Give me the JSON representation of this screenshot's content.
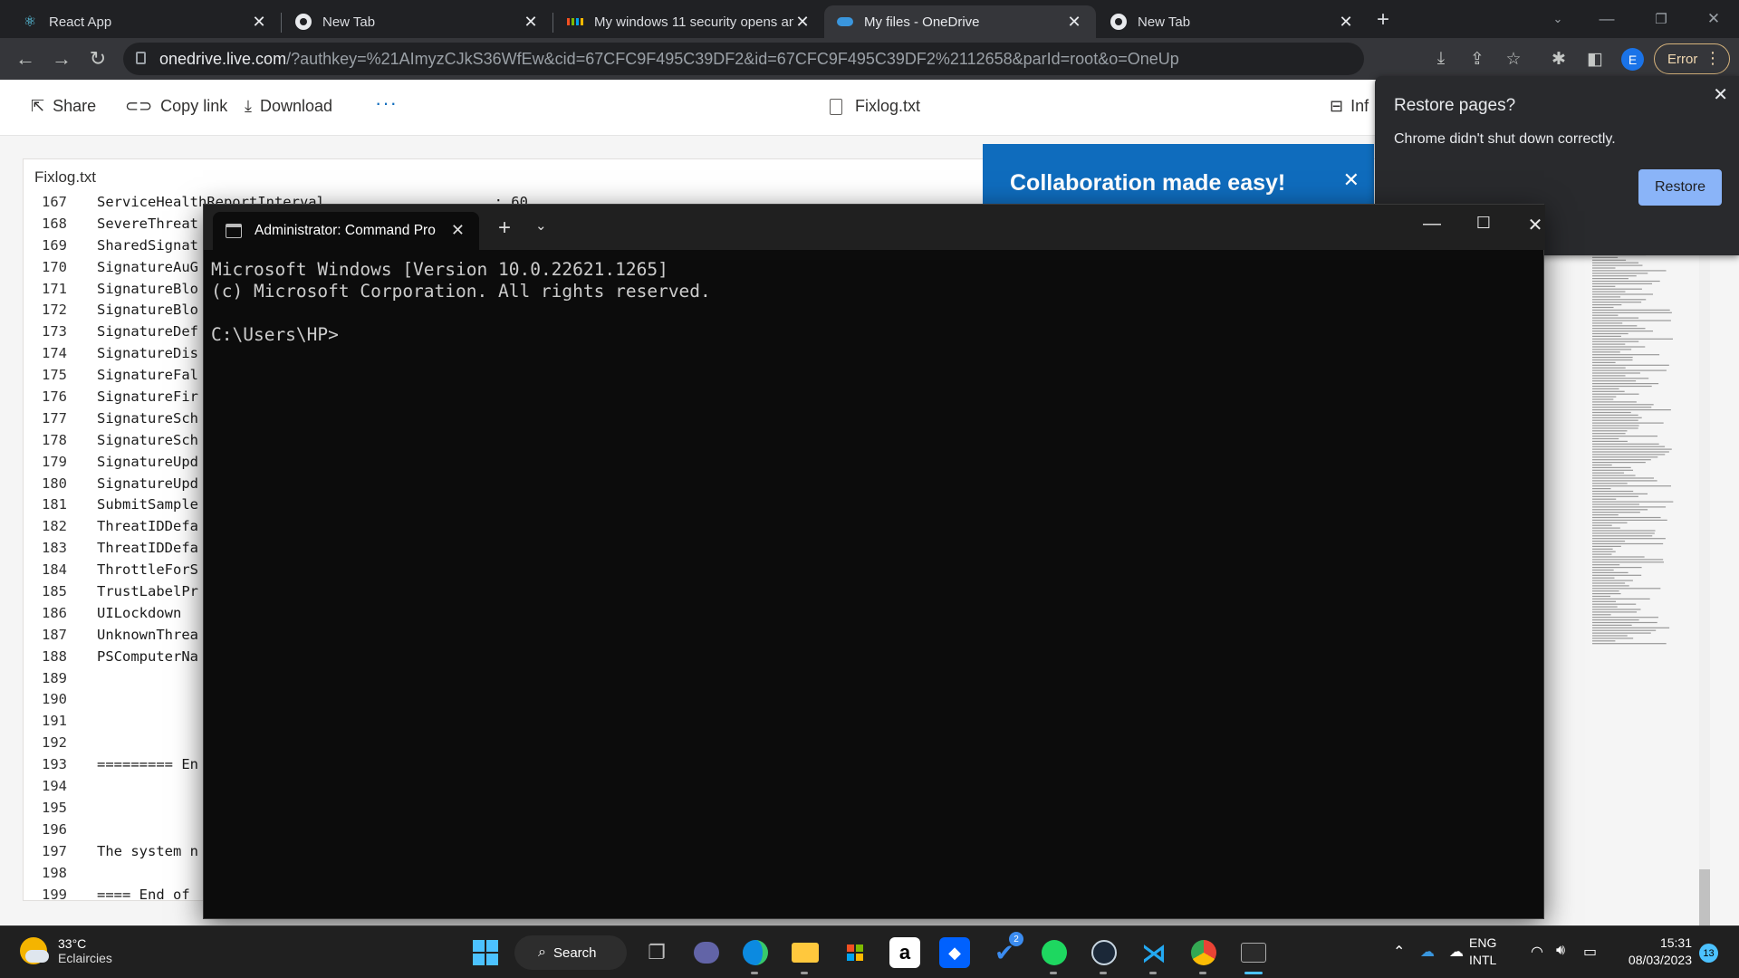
{
  "browser": {
    "tabs": [
      {
        "label": "React App",
        "icon": "react-icon"
      },
      {
        "label": "New Tab",
        "icon": "chrome-icon"
      },
      {
        "label": "My windows 11 security opens an",
        "icon": "microsoft-icon"
      },
      {
        "label": "My files - OneDrive",
        "icon": "onedrive-icon",
        "active": true
      },
      {
        "label": "New Tab",
        "icon": "chrome-icon"
      }
    ],
    "url_host": "onedrive.live.com",
    "url_rest": "/?authkey=%21AImyzCJkS36WfEw&cid=67CFC9F495C39DF2&id=67CFC9F495C39DF2%2112658&parId=root&o=OneUp",
    "profile_initial": "E",
    "error_label": "Error"
  },
  "onedrive": {
    "share": "Share",
    "copy_link": "Copy link",
    "download": "Download",
    "more": "···",
    "file_name": "Fixlog.txt",
    "info": "Inf",
    "viewer_title": "Fixlog.txt",
    "collab_banner": "Collaboration made easy!"
  },
  "file_lines": [
    {
      "n": "167",
      "t": "ServiceHealthReportInterval                    : 60"
    },
    {
      "n": "168",
      "t": "SevereThreat"
    },
    {
      "n": "169",
      "t": "SharedSignat"
    },
    {
      "n": "170",
      "t": "SignatureAuG"
    },
    {
      "n": "171",
      "t": "SignatureBlo"
    },
    {
      "n": "172",
      "t": "SignatureBlo"
    },
    {
      "n": "173",
      "t": "SignatureDef"
    },
    {
      "n": "174",
      "t": "SignatureDis"
    },
    {
      "n": "175",
      "t": "SignatureFal"
    },
    {
      "n": "176",
      "t": "SignatureFir"
    },
    {
      "n": "177",
      "t": "SignatureSch"
    },
    {
      "n": "178",
      "t": "SignatureSch"
    },
    {
      "n": "179",
      "t": "SignatureUpd"
    },
    {
      "n": "180",
      "t": "SignatureUpd"
    },
    {
      "n": "181",
      "t": "SubmitSample"
    },
    {
      "n": "182",
      "t": "ThreatIDDefa"
    },
    {
      "n": "183",
      "t": "ThreatIDDefa"
    },
    {
      "n": "184",
      "t": "ThrottleForS"
    },
    {
      "n": "185",
      "t": "TrustLabelPr"
    },
    {
      "n": "186",
      "t": "UILockdown"
    },
    {
      "n": "187",
      "t": "UnknownThrea"
    },
    {
      "n": "188",
      "t": "PSComputerNa"
    },
    {
      "n": "189",
      "t": ""
    },
    {
      "n": "190",
      "t": ""
    },
    {
      "n": "191",
      "t": ""
    },
    {
      "n": "192",
      "t": ""
    },
    {
      "n": "193",
      "t": "========= En"
    },
    {
      "n": "194",
      "t": ""
    },
    {
      "n": "195",
      "t": ""
    },
    {
      "n": "196",
      "t": ""
    },
    {
      "n": "197",
      "t": "The system n"
    },
    {
      "n": "198",
      "t": ""
    },
    {
      "n": "199",
      "t": "==== End of"
    }
  ],
  "restore_popup": {
    "title": "Restore pages?",
    "message": "Chrome didn't shut down correctly.",
    "button": "Restore"
  },
  "terminal": {
    "tab_title": "Administrator: Command Pro",
    "lines": [
      "Microsoft Windows [Version 10.0.22621.1265]",
      "(c) Microsoft Corporation. All rights reserved.",
      "",
      "C:\\Users\\HP>"
    ]
  },
  "taskbar": {
    "temperature": "33°C",
    "weather": "Eclaircies",
    "search": "Search",
    "lang1": "ENG",
    "lang2": "INTL",
    "time": "15:31",
    "date": "08/03/2023",
    "notification_count": "13",
    "todo_badge": "2"
  }
}
